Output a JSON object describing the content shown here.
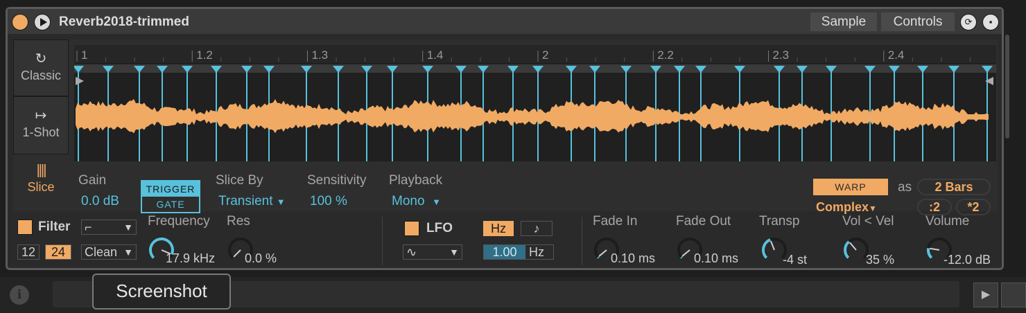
{
  "device": {
    "title": "Reverb2018-trimmed",
    "tabs": [
      "Sample",
      "Controls"
    ]
  },
  "modes": {
    "classic": "Classic",
    "one_shot": "1-Shot",
    "slice": "Slice"
  },
  "ruler": [
    "1",
    "1.2",
    "1.3",
    "1.4",
    "2",
    "2.2",
    "2.3",
    "2.4"
  ],
  "params": {
    "gain_label": "Gain",
    "gain_value": "0.0 dB",
    "trigger": "TRIGGER",
    "gate": "GATE",
    "slice_by_label": "Slice By",
    "slice_by_value": "Transient",
    "sensitivity_label": "Sensitivity",
    "sensitivity_value": "100 %",
    "playback_label": "Playback",
    "playback_value": "Mono",
    "warp": "WARP",
    "as": "as",
    "bars": "2 Bars",
    "warp_mode": "Complex",
    "half": ":2",
    "double": "*2"
  },
  "filter": {
    "label": "Filter",
    "slope_12": "12",
    "slope_24": "24",
    "circuit": "Clean",
    "freq_label": "Frequency",
    "freq_value": "17.9 kHz",
    "res_label": "Res",
    "res_value": "0.0 %"
  },
  "lfo": {
    "label": "LFO",
    "hz": "Hz",
    "note": "♪",
    "rate_value": "1.00",
    "rate_unit": "Hz"
  },
  "env": {
    "fade_in_label": "Fade In",
    "fade_in_value": "0.10 ms",
    "fade_out_label": "Fade Out",
    "fade_out_value": "0.10 ms",
    "transp_label": "Transp",
    "transp_value": "-4 st",
    "vol_vel_label": "Vol < Vel",
    "vol_vel_value": "35 %",
    "volume_label": "Volume",
    "volume_value": "-12.0 dB"
  },
  "knob_levels": {
    "frequency": 0.92,
    "res": 0.0,
    "fade_in": 0.02,
    "fade_out": 0.02,
    "transp": 0.42,
    "vol_vel": 0.35,
    "volume": 0.2
  },
  "tooltip": "Screenshot",
  "colors": {
    "accent_orange": "#f1aa63",
    "accent_blue": "#58c1dc",
    "waveform": "#f1aa63"
  }
}
